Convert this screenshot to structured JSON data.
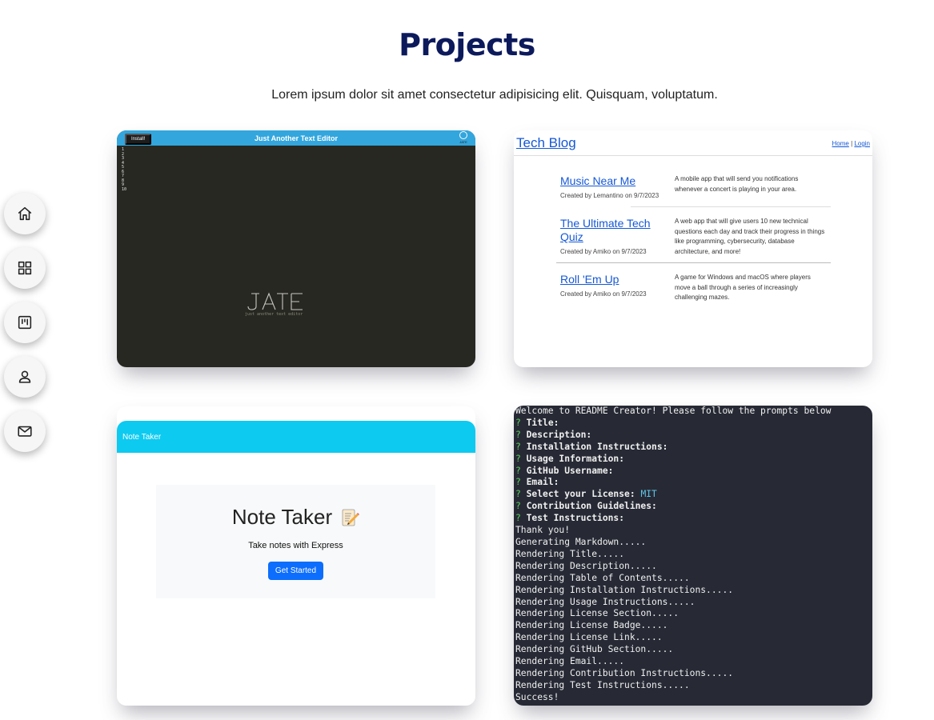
{
  "header": {
    "title": "Projects",
    "subtitle": "Lorem ipsum dolor sit amet consectetur adipisicing elit. Quisquam, voluptatum."
  },
  "side_nav": [
    {
      "icon": "home-icon"
    },
    {
      "icon": "grid-icon"
    },
    {
      "icon": "kanban-icon"
    },
    {
      "icon": "user-icon"
    },
    {
      "icon": "mail-icon"
    }
  ],
  "projects": {
    "jate": {
      "install_label": "Install!",
      "title": "Just Another Text Editor",
      "logo_text": "JATE",
      "gutter": "1\n2\n3\n4\n5\n6\n7\n8\n9\n10",
      "comment": "just another text editor"
    },
    "blog": {
      "title": "Tech Blog",
      "nav_home": "Home",
      "nav_sep": "|",
      "nav_login": "Login",
      "posts": [
        {
          "title": "Music Near Me",
          "meta": "Created by Lemantino on 9/7/2023",
          "desc": "A mobile app that will send you notifications whenever a concert is playing in your area."
        },
        {
          "title": "The Ultimate Tech Quiz",
          "meta": "Created by Amiko on 9/7/2023",
          "desc": "A web app that will give users 10 new technical questions each day and track their progress in things like programming, cybersecurity, database architecture, and more!"
        },
        {
          "title": "Roll 'Em Up",
          "meta": "Created by Amiko on 9/7/2023",
          "desc": "A game for Windows and macOS where players move a ball through a series of increasingly challenging mazes."
        }
      ]
    },
    "note": {
      "bar_title": "Note Taker",
      "heading": "Note Taker",
      "lead": "Take notes with Express",
      "button": "Get Started"
    },
    "readme": {
      "intro": "Welcome to README Creator! Please follow the prompts below",
      "prompts": [
        "Title:",
        "Description:",
        "Installation Instructions:",
        "Usage Information:",
        "GitHub Username:",
        "Email:",
        "Select your License:",
        "Contribution Guidelines:",
        "Test Instructions:"
      ],
      "license_value": "MIT",
      "output": [
        "Thank you!",
        "Generating Markdown.....",
        "Rendering Title.....",
        "Rendering Description.....",
        "Rendering Table of Contents.....",
        "Rendering Installation Instructions.....",
        "Rendering Usage Instructions.....",
        "Rendering License Section.....",
        "Rendering License Badge.....",
        "Rendering License Link.....",
        "Rendering GitHub Section.....",
        "Rendering Email.....",
        "Rendering Contribution Instructions.....",
        "Rendering Test Instructions.....",
        "Success!"
      ]
    }
  },
  "colors": {
    "title": "#0c1a5c",
    "jate_bar": "#33a6dd",
    "link": "#1558d6",
    "note_bar": "#0dcaf0",
    "note_button": "#0d6efd",
    "terminal_bg": "#272a35"
  }
}
